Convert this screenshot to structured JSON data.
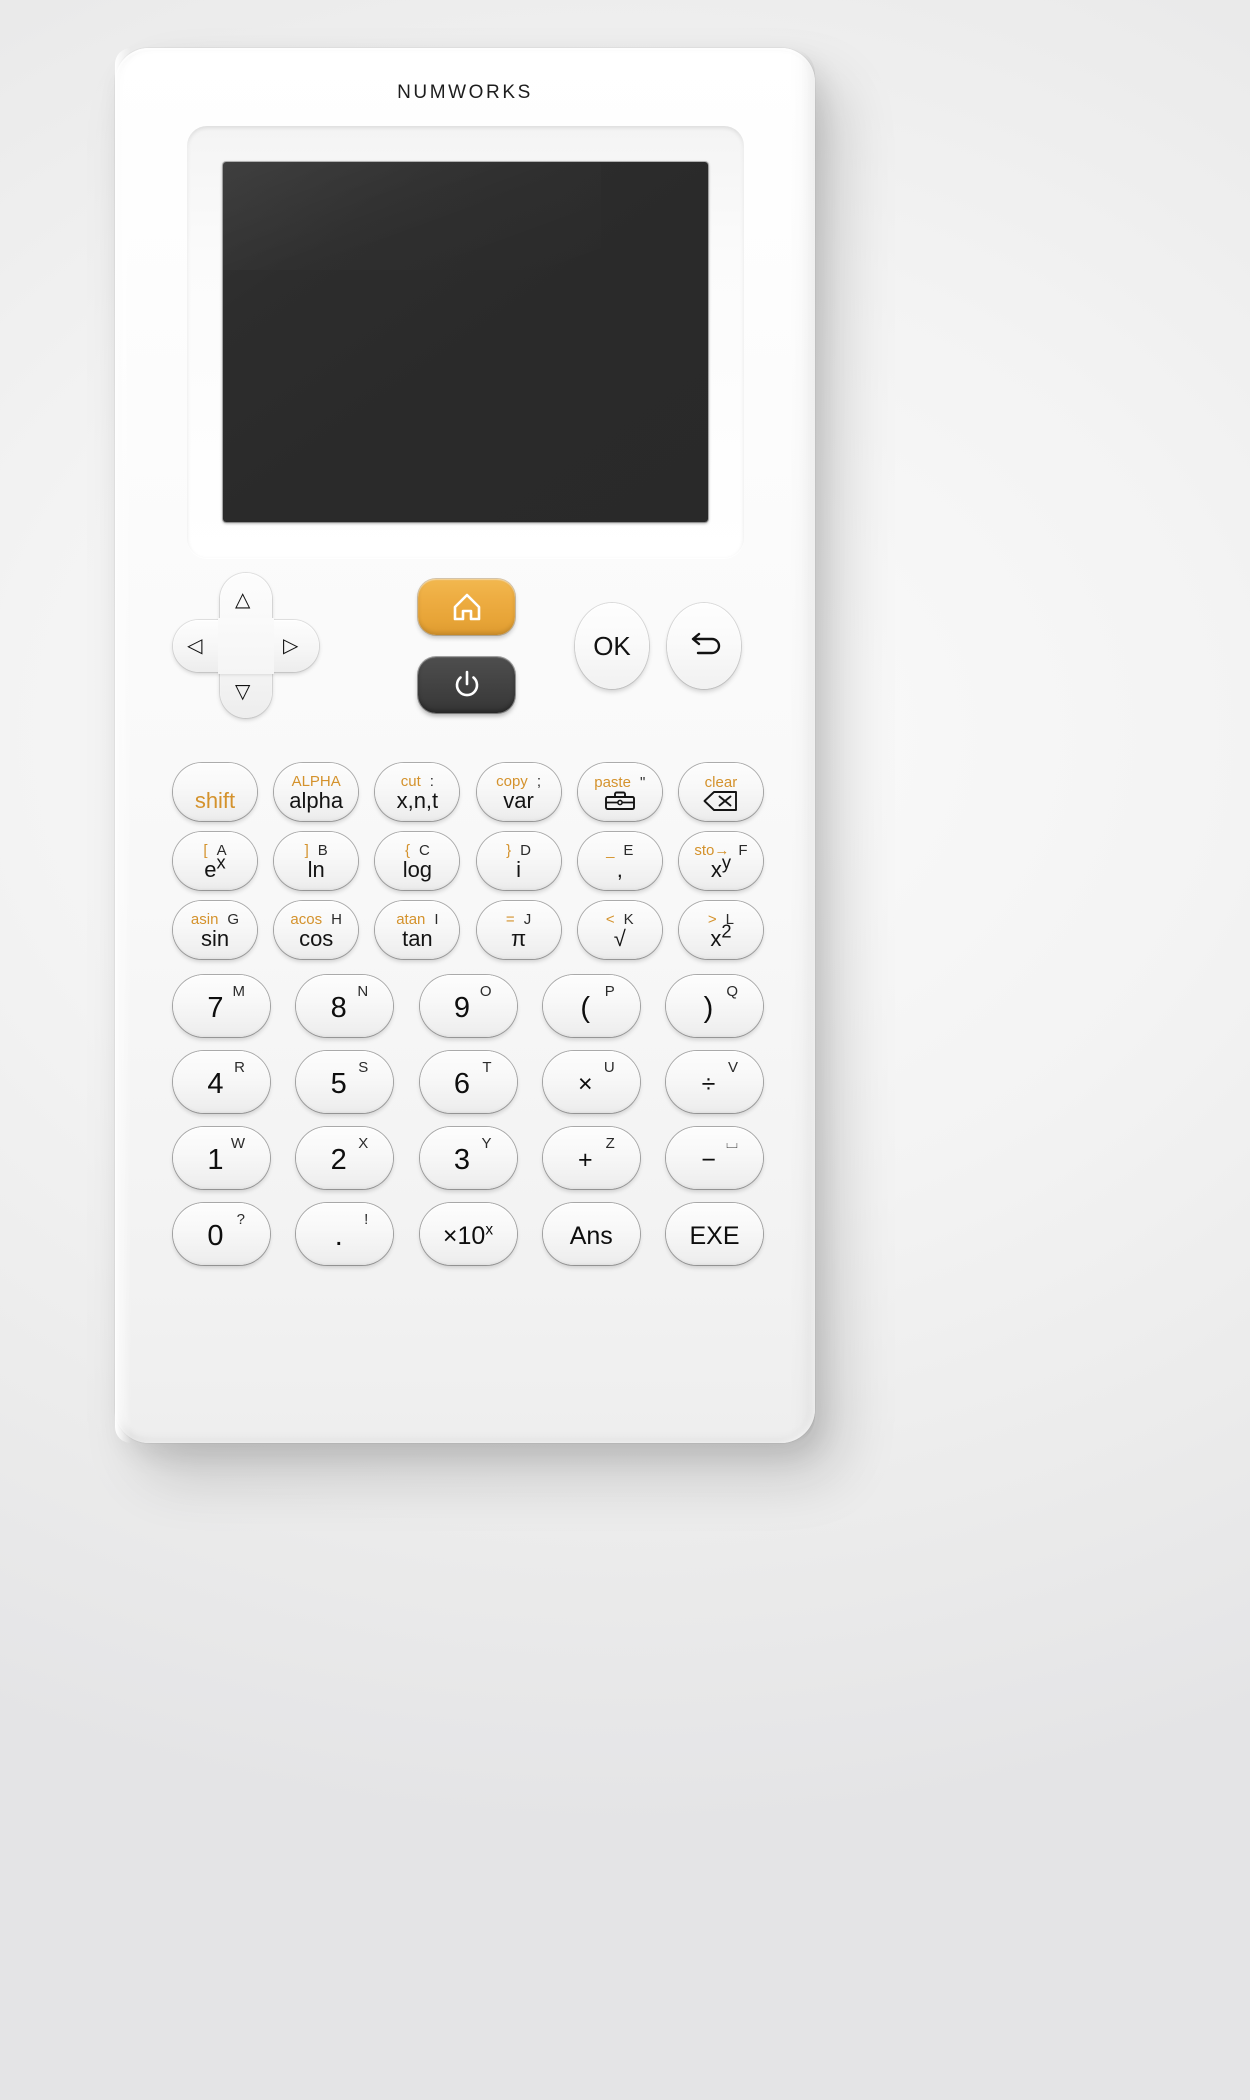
{
  "device": {
    "brand": "NUMWORKS",
    "screen_color": "#2b2b2b",
    "accent_color": "#eead42",
    "shift_color": "#d4922c",
    "body_color": "#f8f8f8"
  },
  "navigation": {
    "dpad": {
      "up": "△",
      "down": "▽",
      "left": "◁",
      "right": "▷"
    },
    "home": {
      "label": "home-icon"
    },
    "power": {
      "label": "power-icon"
    },
    "ok": {
      "label": "OK"
    },
    "back": {
      "label": "back-icon"
    }
  },
  "keypad": {
    "rows": [
      [
        {
          "name": "shift",
          "shift": "",
          "alpha": "",
          "primary": "shift",
          "style": "shift"
        },
        {
          "name": "alpha",
          "shift": "ALPHA",
          "alpha": "",
          "primary": "alpha"
        },
        {
          "name": "xnt",
          "shift": "cut",
          "alpha": ":",
          "primary": "x,n,t"
        },
        {
          "name": "var",
          "shift": "copy",
          "alpha": ";",
          "primary": "var"
        },
        {
          "name": "toolbox",
          "shift": "paste",
          "alpha": "\"",
          "primary": "toolbox-icon",
          "icon": "toolbox"
        },
        {
          "name": "backspace",
          "shift": "clear",
          "alpha": "",
          "primary": "backspace-icon",
          "icon": "backspace"
        }
      ],
      [
        {
          "name": "exp",
          "shift": "[",
          "alpha": "A",
          "primary": "e",
          "sup": "x"
        },
        {
          "name": "ln",
          "shift": "]",
          "alpha": "B",
          "primary": "ln"
        },
        {
          "name": "log",
          "shift": "{",
          "alpha": "C",
          "primary": "log"
        },
        {
          "name": "imaginary",
          "shift": "}",
          "alpha": "D",
          "primary": "i"
        },
        {
          "name": "comma",
          "shift": "_",
          "alpha": "E",
          "primary": ","
        },
        {
          "name": "power",
          "shift": "sto→",
          "alpha": "F",
          "primary": "x",
          "sup": "y"
        }
      ],
      [
        {
          "name": "sin",
          "shift": "asin",
          "alpha": "G",
          "primary": "sin"
        },
        {
          "name": "cos",
          "shift": "acos",
          "alpha": "H",
          "primary": "cos"
        },
        {
          "name": "tan",
          "shift": "atan",
          "alpha": "I",
          "primary": "tan"
        },
        {
          "name": "pi",
          "shift": "=",
          "alpha": "J",
          "primary": "π"
        },
        {
          "name": "sqrt",
          "shift": "<",
          "alpha": "K",
          "primary": "√"
        },
        {
          "name": "square",
          "shift": ">",
          "alpha": "L",
          "primary": "x",
          "sup": "2"
        }
      ]
    ],
    "pad_rows": [
      [
        {
          "name": "seven",
          "glyph": "7",
          "corner": "M"
        },
        {
          "name": "eight",
          "glyph": "8",
          "corner": "N"
        },
        {
          "name": "nine",
          "glyph": "9",
          "corner": "O"
        },
        {
          "name": "left-parenthesis",
          "glyph": "(",
          "corner": "P"
        },
        {
          "name": "right-parenthesis",
          "glyph": ")",
          "corner": "Q"
        }
      ],
      [
        {
          "name": "four",
          "glyph": "4",
          "corner": "R"
        },
        {
          "name": "five",
          "glyph": "5",
          "corner": "S"
        },
        {
          "name": "six",
          "glyph": "6",
          "corner": "T"
        },
        {
          "name": "multiply",
          "glyph": "×",
          "corner": "U"
        },
        {
          "name": "divide",
          "glyph": "÷",
          "corner": "V"
        }
      ],
      [
        {
          "name": "one",
          "glyph": "1",
          "corner": "W"
        },
        {
          "name": "two",
          "glyph": "2",
          "corner": "X"
        },
        {
          "name": "three",
          "glyph": "3",
          "corner": "Y"
        },
        {
          "name": "plus",
          "glyph": "+",
          "corner": "Z"
        },
        {
          "name": "minus",
          "glyph": "−",
          "corner": "⌴"
        }
      ],
      [
        {
          "name": "zero",
          "glyph": "0",
          "corner": "?"
        },
        {
          "name": "dot",
          "glyph": ".",
          "corner": "!"
        },
        {
          "name": "exponent",
          "glyph": "×10",
          "sup": "x",
          "corner": ""
        },
        {
          "name": "ans",
          "glyph": "Ans",
          "corner": ""
        },
        {
          "name": "exe",
          "glyph": "EXE",
          "corner": ""
        }
      ]
    ]
  }
}
